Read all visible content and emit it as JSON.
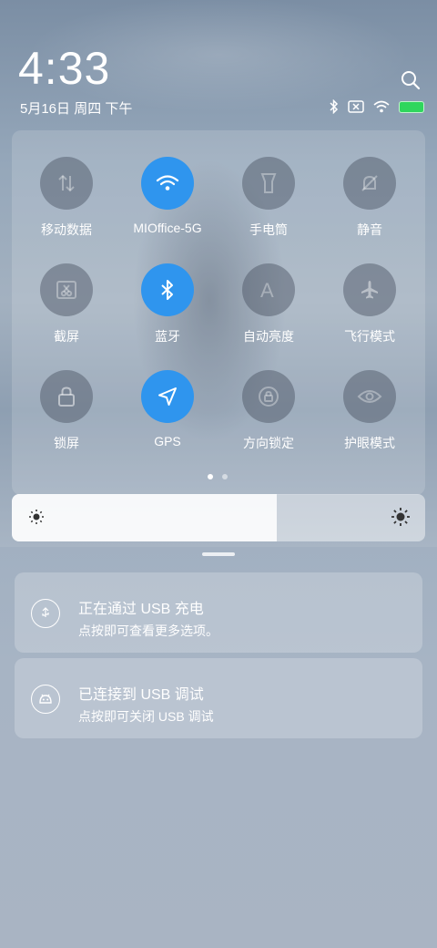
{
  "header": {
    "time": "4:33",
    "date": "5月16日 周四 下午"
  },
  "status_bar": {
    "icons": [
      "bluetooth-icon",
      "sim-card-x-icon",
      "wifi-icon",
      "battery-icon"
    ],
    "battery_color": "#2fd65d",
    "battery_level": 1.0
  },
  "toggles": [
    {
      "name": "mobile-data",
      "label": "移动数据",
      "icon": "mobile-data-icon",
      "on": false
    },
    {
      "name": "wifi",
      "label": "MIOffice-5G",
      "icon": "wifi-icon",
      "on": true
    },
    {
      "name": "flashlight",
      "label": "手电筒",
      "icon": "flashlight-icon",
      "on": false
    },
    {
      "name": "silent",
      "label": "静音",
      "icon": "bell-off-icon",
      "on": false
    },
    {
      "name": "screenshot",
      "label": "截屏",
      "icon": "screenshot-icon",
      "on": false
    },
    {
      "name": "bluetooth",
      "label": "蓝牙",
      "icon": "bluetooth-icon",
      "on": true
    },
    {
      "name": "auto-brightness",
      "label": "自动亮度",
      "icon": "auto-brightness-icon",
      "on": false
    },
    {
      "name": "airplane",
      "label": "飞行模式",
      "icon": "airplane-icon",
      "on": false
    },
    {
      "name": "lock-screen",
      "label": "锁屏",
      "icon": "lock-icon",
      "on": false
    },
    {
      "name": "gps",
      "label": "GPS",
      "icon": "navigation-arrow-icon",
      "on": true
    },
    {
      "name": "rotation-lock",
      "label": "方向锁定",
      "icon": "rotation-lock-icon",
      "on": false
    },
    {
      "name": "eye-care",
      "label": "护眼模式",
      "icon": "eye-icon",
      "on": false
    }
  ],
  "accent_color": "#2f95ee",
  "pager": {
    "pages": 2,
    "current": 1
  },
  "brightness": {
    "level": 0.64
  },
  "notifications": [
    {
      "title": "正在通过 USB 充电",
      "body": "点按即可查看更多选项。",
      "icon": "usb-charging-icon"
    },
    {
      "title": "已连接到 USB 调试",
      "body": "点按即可关闭 USB 调试",
      "icon": "android-debug-icon"
    }
  ]
}
